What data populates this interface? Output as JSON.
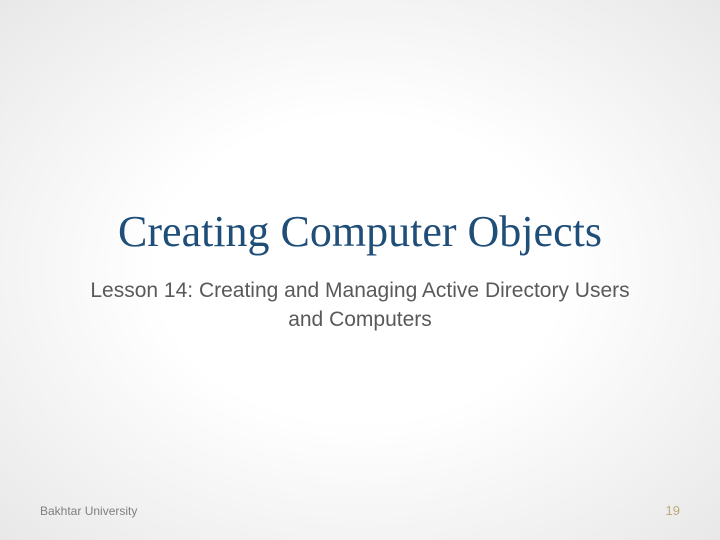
{
  "slide": {
    "title": "Creating Computer Objects",
    "subtitle": "Lesson 14: Creating and Managing Active Directory Users and Computers"
  },
  "footer": {
    "organization": "Bakhtar University",
    "page_number": "19"
  }
}
